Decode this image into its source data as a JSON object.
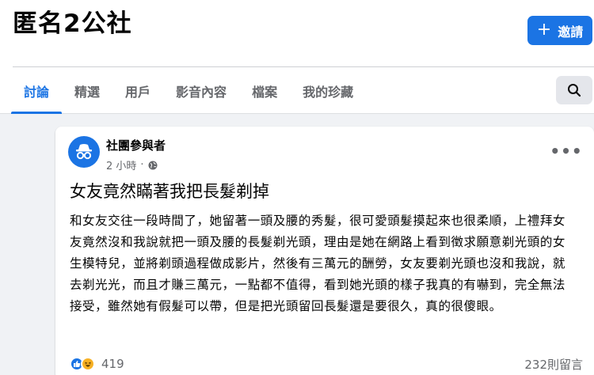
{
  "group": {
    "name": "匿名2公社"
  },
  "actions": {
    "invite_label": "邀請",
    "invite_icon": "plus-icon"
  },
  "tabs": [
    {
      "label": "討論",
      "active": true
    },
    {
      "label": "精選",
      "active": false
    },
    {
      "label": "用戶",
      "active": false
    },
    {
      "label": "影音內容",
      "active": false
    },
    {
      "label": "檔案",
      "active": false
    },
    {
      "label": "我的珍藏",
      "active": false
    }
  ],
  "search": {
    "icon": "search-icon"
  },
  "post": {
    "author": "社團參與者",
    "time": "2 小時",
    "separator": "·",
    "privacy_icon": "globe-icon",
    "title": "女友竟然瞞著我把長髮剃掉",
    "body": "和女友交往一段時間了，她留著一頭及腰的秀髮，很可愛頭髮摸起來也很柔順，上禮拜女友竟然沒和我說就把一頭及腰的長髮剃光頭，理由是她在網路上看到徵求願意剃光頭的女生模特兒，並將剃頭過程做成影片，然後有三萬元的酬勞，女友要剃光頭也沒和我說，就去剃光光，而且才賺三萬元，一點都不值得，看到她光頭的樣子我真的有嚇到，完全無法接受，雖然她有假髮可以帶，但是把光頭留回長髮還是要很久，真的很傻眼。",
    "reaction_count": "419",
    "comment_count": "232則留言"
  },
  "colors": {
    "accent": "#1b74e4",
    "text": "#050505",
    "muted": "#65676b",
    "background": "#f0f2f5"
  }
}
